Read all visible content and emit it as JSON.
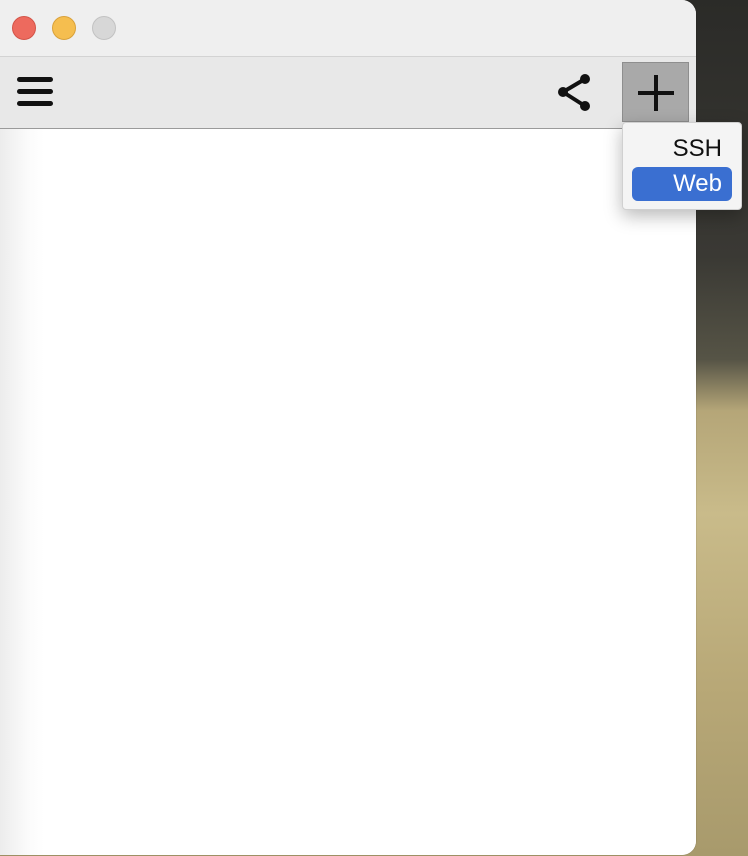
{
  "window": {
    "traffic_lights": [
      "close",
      "minimize",
      "zoom"
    ]
  },
  "toolbar": {
    "menu_icon": "hamburger-menu-icon",
    "share_icon": "share-icon",
    "add_icon": "plus-icon"
  },
  "dropdown": {
    "items": [
      {
        "label": "SSH",
        "selected": false
      },
      {
        "label": "Web",
        "selected": true
      }
    ]
  },
  "colors": {
    "close": "#ed6a5e",
    "minimize": "#f5be4f",
    "zoom": "#d7d7d7",
    "selection": "#3a6fd1"
  }
}
